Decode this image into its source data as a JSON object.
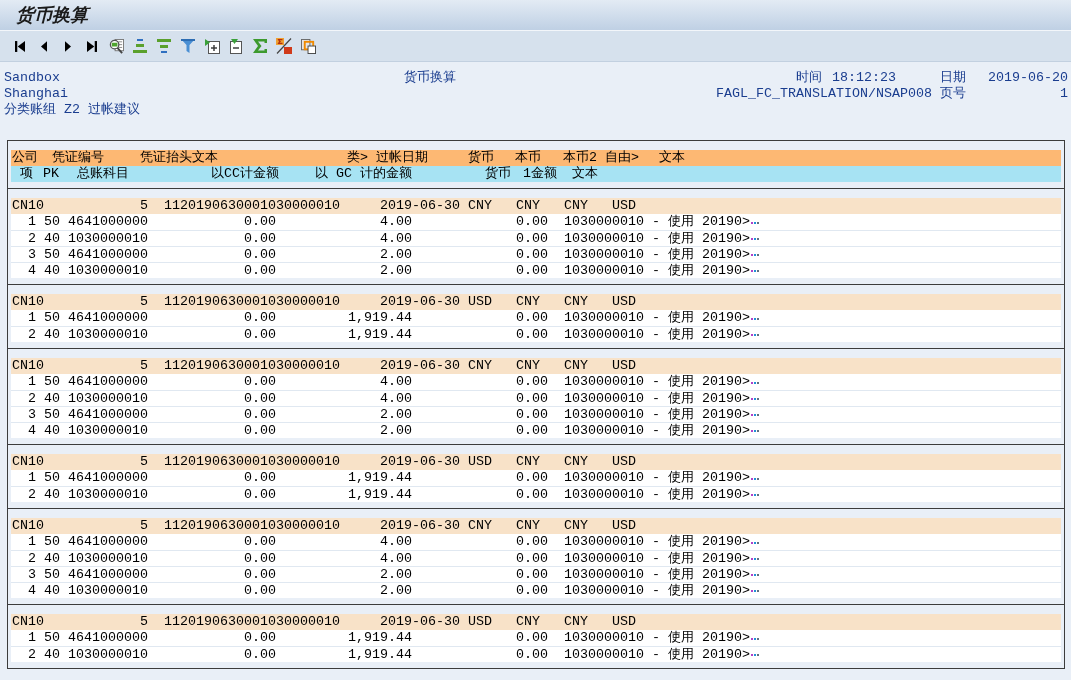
{
  "window": {
    "title": "货币换算"
  },
  "report_header": {
    "lines_left": [
      "Sandbox",
      "Shanghai",
      "分类账组 Z2 过帐建议"
    ],
    "title": "货币换算",
    "time_label": "时间",
    "time": "18:12:23",
    "date_label": "日期",
    "date": "2019-06-20",
    "program": "FAGL_FC_TRANSLATION/NSAP008",
    "page_label": "页号",
    "page": "1"
  },
  "list": {
    "header_row_1": [
      "公司",
      "凭证编号",
      "凭证抬头文本",
      "类>",
      "过帐日期",
      "货币",
      "本币",
      "本币2",
      "自由>",
      "文本"
    ],
    "header_row_2": [
      "项",
      "PK",
      "总账科目",
      "以CC计金额",
      "以 GC 计的金额",
      "货币",
      "1金额",
      "文本"
    ],
    "documents": [
      {
        "company": "CN10",
        "document_number": "5",
        "header_text": "1120190630001030000010",
        "posting_date": "2019-06-30",
        "currency": "CNY",
        "local_currency": "CNY",
        "local_currency_2": "CNY",
        "free_currency": "USD",
        "items": [
          {
            "item": "1",
            "posting_key": "50",
            "account": "4641000000",
            "amount_cc": "0.00",
            "amount_gc": "4.00",
            "amount_lc1": "0.00",
            "text": "1030000010 - 使用 20190>",
            "truncated": true
          },
          {
            "item": "2",
            "posting_key": "40",
            "account": "1030000010",
            "amount_cc": "0.00",
            "amount_gc": "4.00",
            "amount_lc1": "0.00",
            "text": "1030000010 - 使用 20190>",
            "truncated": true
          },
          {
            "item": "3",
            "posting_key": "50",
            "account": "4641000000",
            "amount_cc": "0.00",
            "amount_gc": "2.00",
            "amount_lc1": "0.00",
            "text": "1030000010 - 使用 20190>",
            "truncated": true
          },
          {
            "item": "4",
            "posting_key": "40",
            "account": "1030000010",
            "amount_cc": "0.00",
            "amount_gc": "2.00",
            "amount_lc1": "0.00",
            "text": "1030000010 - 使用 20190>",
            "truncated": true
          }
        ]
      },
      {
        "company": "CN10",
        "document_number": "5",
        "header_text": "1120190630001030000010",
        "posting_date": "2019-06-30",
        "currency": "USD",
        "local_currency": "CNY",
        "local_currency_2": "CNY",
        "free_currency": "USD",
        "items": [
          {
            "item": "1",
            "posting_key": "50",
            "account": "4641000000",
            "amount_cc": "0.00",
            "amount_gc": "1,919.44",
            "amount_lc1": "0.00",
            "text": "1030000010 - 使用 20190>",
            "truncated": true
          },
          {
            "item": "2",
            "posting_key": "40",
            "account": "1030000010",
            "amount_cc": "0.00",
            "amount_gc": "1,919.44",
            "amount_lc1": "0.00",
            "text": "1030000010 - 使用 20190>",
            "truncated": true
          }
        ]
      },
      {
        "company": "CN10",
        "document_number": "5",
        "header_text": "1120190630001030000010",
        "posting_date": "2019-06-30",
        "currency": "CNY",
        "local_currency": "CNY",
        "local_currency_2": "CNY",
        "free_currency": "USD",
        "items": [
          {
            "item": "1",
            "posting_key": "50",
            "account": "4641000000",
            "amount_cc": "0.00",
            "amount_gc": "4.00",
            "amount_lc1": "0.00",
            "text": "1030000010 - 使用 20190>",
            "truncated": true
          },
          {
            "item": "2",
            "posting_key": "40",
            "account": "1030000010",
            "amount_cc": "0.00",
            "amount_gc": "4.00",
            "amount_lc1": "0.00",
            "text": "1030000010 - 使用 20190>",
            "truncated": true
          },
          {
            "item": "3",
            "posting_key": "50",
            "account": "4641000000",
            "amount_cc": "0.00",
            "amount_gc": "2.00",
            "amount_lc1": "0.00",
            "text": "1030000010 - 使用 20190>",
            "truncated": true
          },
          {
            "item": "4",
            "posting_key": "40",
            "account": "1030000010",
            "amount_cc": "0.00",
            "amount_gc": "2.00",
            "amount_lc1": "0.00",
            "text": "1030000010 - 使用 20190>",
            "truncated": true
          }
        ]
      },
      {
        "company": "CN10",
        "document_number": "5",
        "header_text": "1120190630001030000010",
        "posting_date": "2019-06-30",
        "currency": "USD",
        "local_currency": "CNY",
        "local_currency_2": "CNY",
        "free_currency": "USD",
        "items": [
          {
            "item": "1",
            "posting_key": "50",
            "account": "4641000000",
            "amount_cc": "0.00",
            "amount_gc": "1,919.44",
            "amount_lc1": "0.00",
            "text": "1030000010 - 使用 20190>",
            "truncated": true
          },
          {
            "item": "2",
            "posting_key": "40",
            "account": "1030000010",
            "amount_cc": "0.00",
            "amount_gc": "1,919.44",
            "amount_lc1": "0.00",
            "text": "1030000010 - 使用 20190>",
            "truncated": true
          }
        ]
      },
      {
        "company": "CN10",
        "document_number": "5",
        "header_text": "1120190630001030000010",
        "posting_date": "2019-06-30",
        "currency": "CNY",
        "local_currency": "CNY",
        "local_currency_2": "CNY",
        "free_currency": "USD",
        "items": [
          {
            "item": "1",
            "posting_key": "50",
            "account": "4641000000",
            "amount_cc": "0.00",
            "amount_gc": "4.00",
            "amount_lc1": "0.00",
            "text": "1030000010 - 使用 20190>",
            "truncated": true
          },
          {
            "item": "2",
            "posting_key": "40",
            "account": "1030000010",
            "amount_cc": "0.00",
            "amount_gc": "4.00",
            "amount_lc1": "0.00",
            "text": "1030000010 - 使用 20190>",
            "truncated": true
          },
          {
            "item": "3",
            "posting_key": "50",
            "account": "4641000000",
            "amount_cc": "0.00",
            "amount_gc": "2.00",
            "amount_lc1": "0.00",
            "text": "1030000010 - 使用 20190>",
            "truncated": true
          },
          {
            "item": "4",
            "posting_key": "40",
            "account": "1030000010",
            "amount_cc": "0.00",
            "amount_gc": "2.00",
            "amount_lc1": "0.00",
            "text": "1030000010 - 使用 20190>",
            "truncated": true
          }
        ]
      },
      {
        "company": "CN10",
        "document_number": "5",
        "header_text": "1120190630001030000010",
        "posting_date": "2019-06-30",
        "currency": "USD",
        "local_currency": "CNY",
        "local_currency_2": "CNY",
        "free_currency": "USD",
        "items": [
          {
            "item": "1",
            "posting_key": "50",
            "account": "4641000000",
            "amount_cc": "0.00",
            "amount_gc": "1,919.44",
            "amount_lc1": "0.00",
            "text": "1030000010 - 使用 20190>",
            "truncated": true
          },
          {
            "item": "2",
            "posting_key": "40",
            "account": "1030000010",
            "amount_cc": "0.00",
            "amount_gc": "1,919.44",
            "amount_lc1": "0.00",
            "text": "1030000010 - 使用 20190>",
            "truncated": true
          }
        ]
      }
    ]
  }
}
